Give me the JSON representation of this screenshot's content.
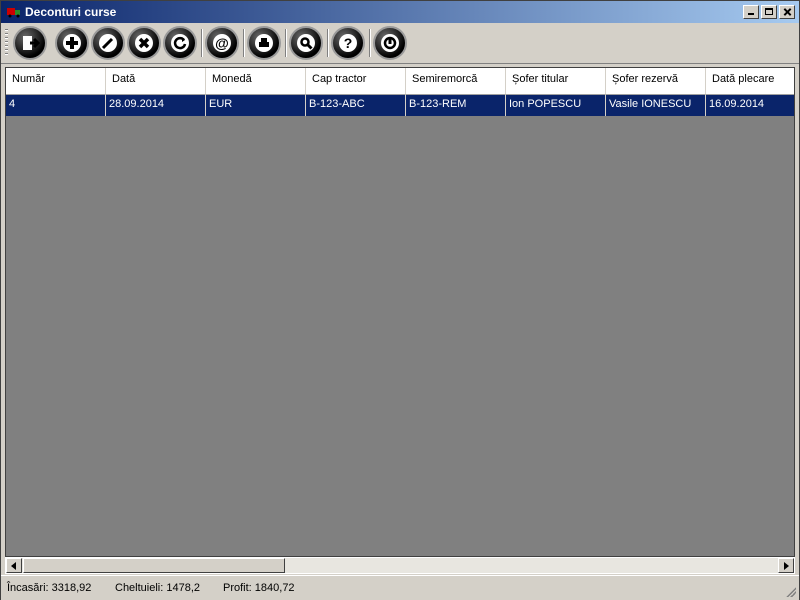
{
  "window": {
    "title": "Deconturi curse"
  },
  "toolbar": {
    "buttons": [
      {
        "icon": "exit-icon"
      },
      {
        "icon": "add-icon"
      },
      {
        "icon": "edit-icon"
      },
      {
        "icon": "delete-icon"
      },
      {
        "icon": "refresh-icon"
      },
      {
        "icon": "email-icon"
      },
      {
        "icon": "print-icon"
      },
      {
        "icon": "search-icon"
      },
      {
        "icon": "help-icon"
      },
      {
        "icon": "power-icon"
      }
    ]
  },
  "grid": {
    "columns": [
      "Număr",
      "Dată",
      "Monedă",
      "Cap tractor",
      "Semiremorcă",
      "Șofer titular",
      "Șofer rezervă",
      "Dată plecare"
    ],
    "rows": [
      [
        "4",
        "28.09.2014",
        "EUR",
        "B-123-ABC",
        "B-123-REM",
        "Ion POPESCU",
        "Vasile IONESCU",
        "16.09.2014"
      ]
    ]
  },
  "status": {
    "incasari": "Încasări: 3318,92",
    "cheltuieli": "Cheltuieli: 1478,2",
    "profit": "Profit: 1840,72"
  },
  "colors": {
    "title_start": "#0a246a",
    "title_end": "#a6caf0",
    "selection": "#0a246a",
    "grid_bg": "#808080"
  }
}
